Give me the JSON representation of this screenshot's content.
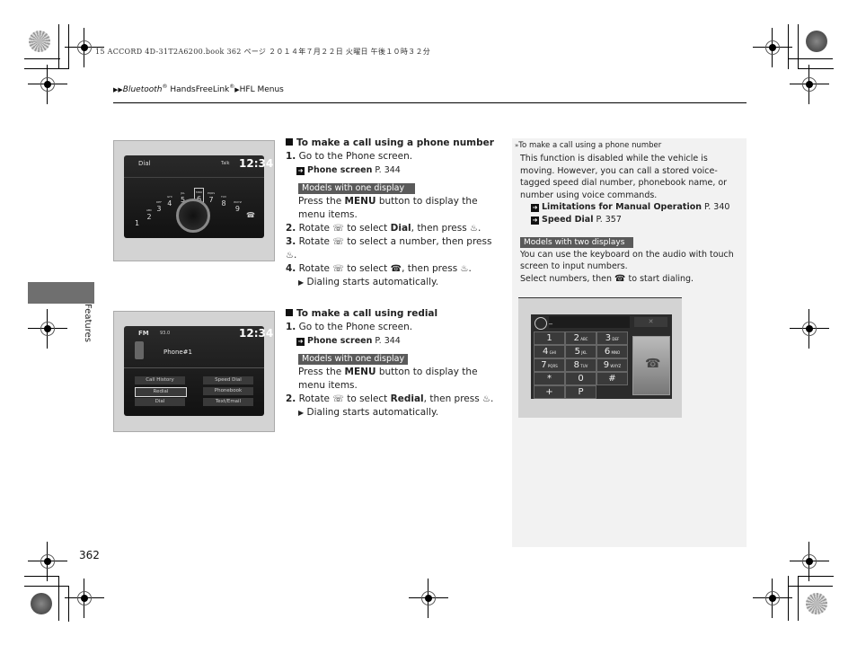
{
  "print_header": {
    "meta": "15 ACCORD 4D-31T2A6200.book  362 ページ  ２０１４年７月２２日  火曜日  午後１０時３２分"
  },
  "breadcrumb": {
    "arrow": "▶▶",
    "part1_italic": "Bluetooth",
    "part1_sup": "®",
    "part1_rest": " HandsFreeLink",
    "part1_sup2": "®",
    "sep": "▶",
    "part2": "HFL Menus"
  },
  "side_tab": {
    "label": "Features"
  },
  "page_number": "362",
  "screenshot_dial": {
    "title": "Dial",
    "status": "Talk",
    "clock": "12:34",
    "keys": [
      {
        "digit": "1",
        "letters": ""
      },
      {
        "digit": "2",
        "letters": "ABC"
      },
      {
        "digit": "3",
        "letters": "DEF"
      },
      {
        "digit": "4",
        "letters": "GHI"
      },
      {
        "digit": "5",
        "letters": "JKL"
      },
      {
        "digit": "6",
        "letters": "MNO"
      },
      {
        "digit": "7",
        "letters": "PQRS"
      },
      {
        "digit": "8",
        "letters": "TUV"
      },
      {
        "digit": "9",
        "letters": "WXYZ"
      }
    ]
  },
  "screenshot_redial": {
    "source": "FM",
    "freq": "93.0",
    "clock": "12:34",
    "phone_label": "Phone#1",
    "menu": [
      "Call History",
      "Speed Dial",
      "Redial",
      "Phonebook",
      "Dial",
      "Text/Email"
    ],
    "selected": "Redial"
  },
  "section_phone_number": {
    "title": "To make a call using a phone number",
    "step1": {
      "num": "1.",
      "text": "Go to the Phone screen."
    },
    "step1_ref": {
      "label": "Phone screen",
      "page": "P. 344"
    },
    "badge": "Models with one display",
    "menu_text_pre": "Press the ",
    "menu_text_bold": "MENU",
    "menu_text_post": " button to display the menu items.",
    "step2": {
      "num": "2.",
      "pre": "Rotate ",
      "mid": " to select ",
      "bold": "Dial",
      "post": ", then press "
    },
    "step3": {
      "num": "3.",
      "pre": "Rotate ",
      "post": " to select a number, then press "
    },
    "step4": {
      "num": "4.",
      "pre": "Rotate ",
      "mid": " to select ",
      "post": ", then press "
    },
    "result": "Dialing starts automatically."
  },
  "section_redial": {
    "title": "To make a call using redial",
    "step1": {
      "num": "1.",
      "text": "Go to the Phone screen."
    },
    "step1_ref": {
      "label": "Phone screen",
      "page": "P. 344"
    },
    "badge": "Models with one display",
    "menu_text_pre": "Press the ",
    "menu_text_bold": "MENU",
    "menu_text_post": " button to display the menu items.",
    "step2": {
      "num": "2.",
      "pre": "Rotate ",
      "mid": " to select ",
      "bold": "Redial",
      "post": ", then press "
    },
    "result": "Dialing starts automatically."
  },
  "note": {
    "title": "To make a call using a phone number",
    "para1": "This function is disabled while the vehicle is moving. However, you can call a stored voice-tagged speed dial number, phonebook name, or number using voice commands.",
    "refs": [
      {
        "label": "Limitations for Manual Operation",
        "page": "P. 340"
      },
      {
        "label": "Speed Dial",
        "page": "P. 357"
      }
    ],
    "badge": "Models with two displays",
    "para2": "You can use the keyboard on the audio with touch screen to input numbers.",
    "para3_pre": "Select numbers, then ",
    "para3_post": " to start dialing."
  },
  "keypad": {
    "keys": [
      {
        "d": "1",
        "l": ""
      },
      {
        "d": "2",
        "l": "ABC"
      },
      {
        "d": "3",
        "l": "DEF"
      },
      {
        "d": "4",
        "l": "GHI"
      },
      {
        "d": "5",
        "l": "JKL"
      },
      {
        "d": "6",
        "l": "MNO"
      },
      {
        "d": "7",
        "l": "PQRS"
      },
      {
        "d": "8",
        "l": "TUV"
      },
      {
        "d": "9",
        "l": "WXYZ"
      },
      {
        "d": "*",
        "l": ""
      },
      {
        "d": "0",
        "l": ""
      },
      {
        "d": "#",
        "l": ""
      },
      {
        "d": "+",
        "l": ""
      },
      {
        "d": "P",
        "l": ""
      }
    ],
    "input": "_",
    "clear_label": "✕"
  },
  "icons": {
    "knob": "☏",
    "press": "♨",
    "call": "☎",
    "ref": "➜",
    "play": "▶"
  }
}
